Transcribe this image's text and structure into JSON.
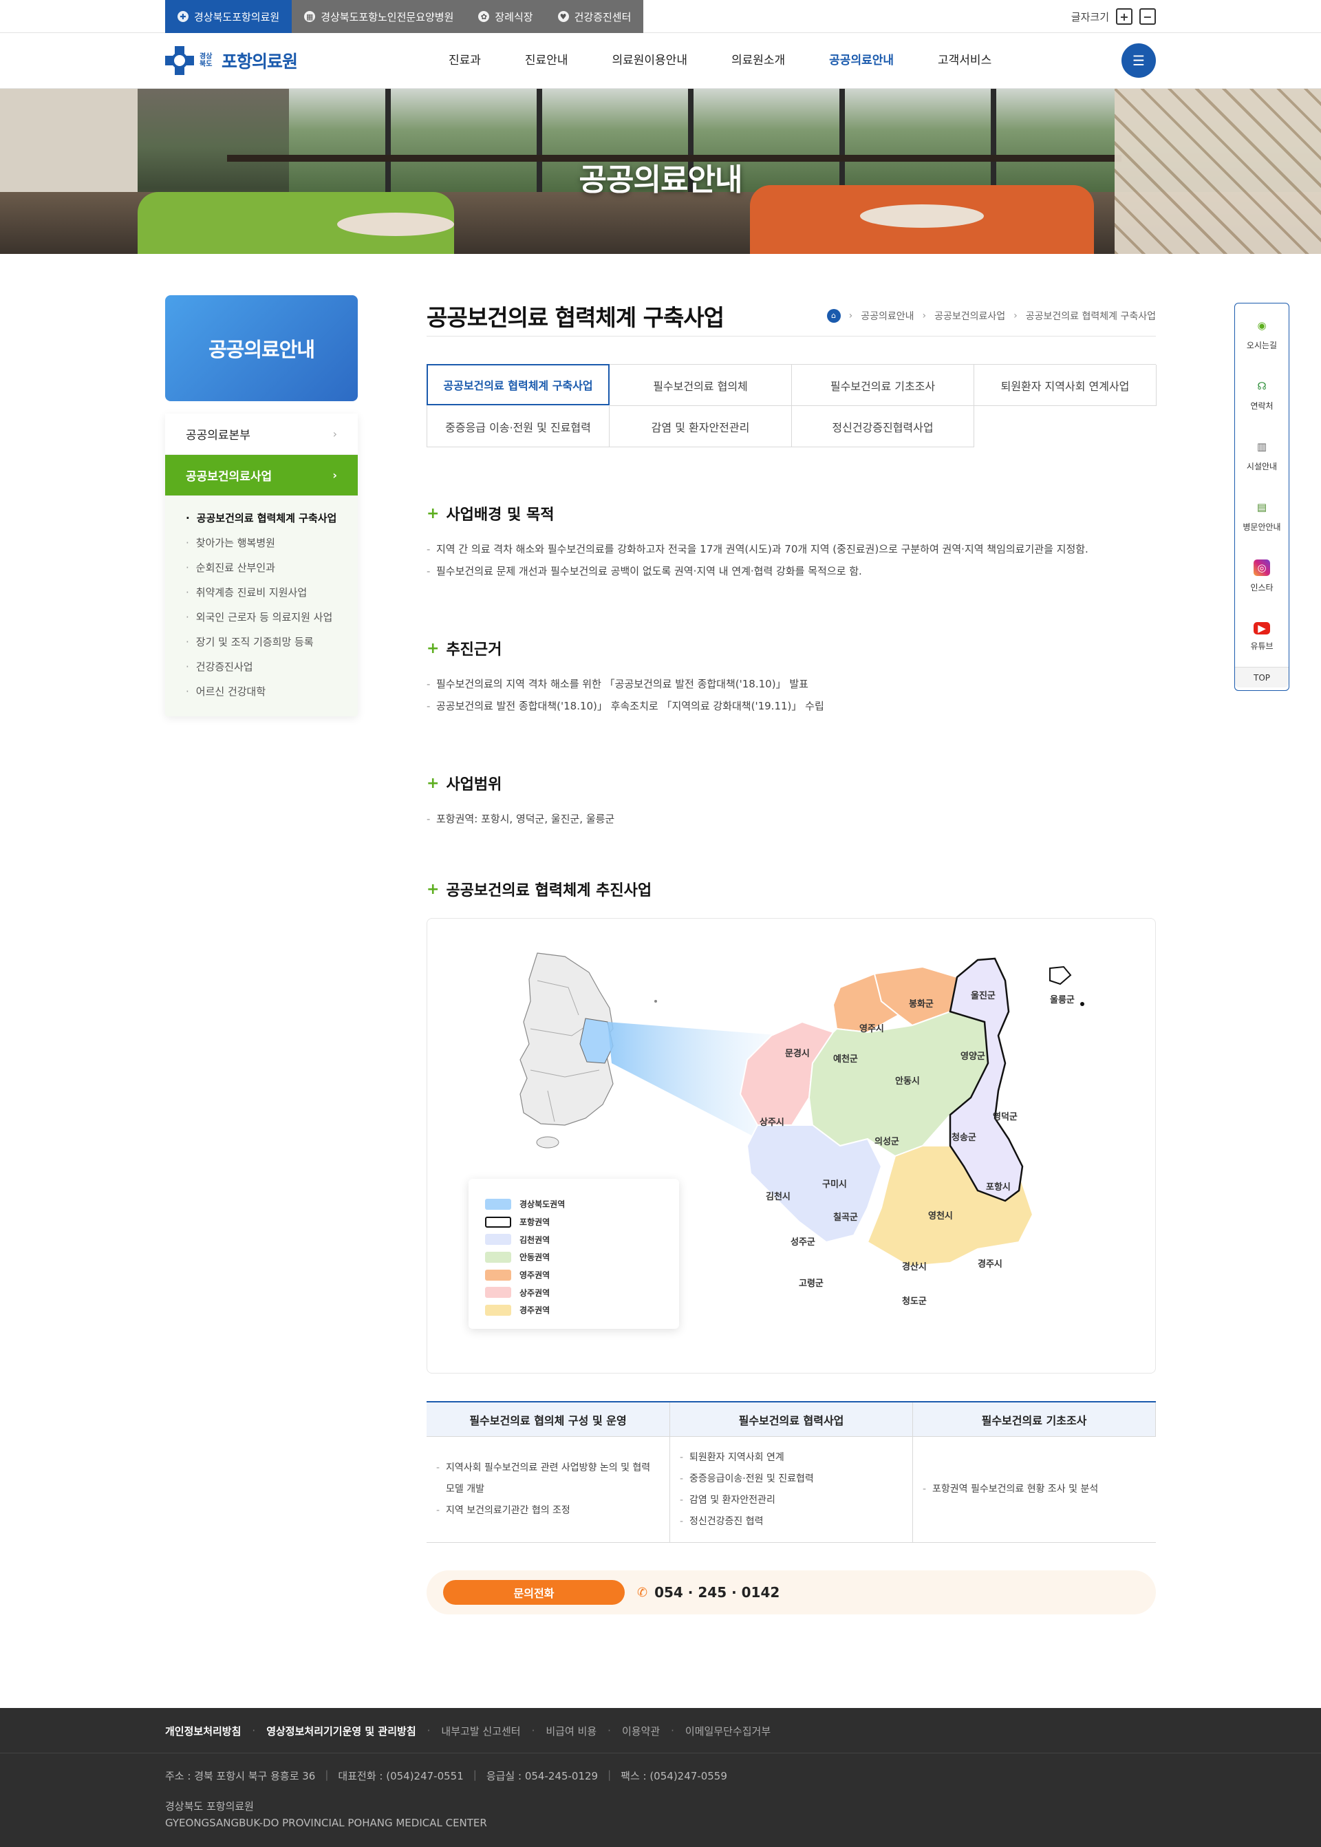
{
  "topbar": {
    "family": [
      {
        "label": "경상북도포항의료원",
        "icon": "cross-icon"
      },
      {
        "label": "경상북도포항노인전문요양병원",
        "icon": "building-icon"
      },
      {
        "label": "장례식장",
        "icon": "flower-icon"
      },
      {
        "label": "건강증진센터",
        "icon": "heart-icon"
      }
    ],
    "font_label": "글자크기",
    "font_plus": "+",
    "font_minus": "−"
  },
  "header": {
    "logo_small": "경상북도",
    "logo_name": "포항의료원",
    "menu": [
      "진료과",
      "진료안내",
      "의료원이용안내",
      "의료원소개",
      "공공의료안내",
      "고객서비스"
    ],
    "active_menu": "공공의료안내",
    "allmenu_icon": "☰"
  },
  "visual": {
    "title": "공공의료안내"
  },
  "lnb": {
    "title": "공공의료안내",
    "depth1": [
      {
        "label": "공공의료본부",
        "arrow": "›"
      },
      {
        "label": "공공보건의료사업",
        "arrow": "›"
      }
    ],
    "depth2": [
      "공공보건의료 협력체계 구축사업",
      "찾아가는 행복병원",
      "순회진료 산부인과",
      "취약계층 진료비 지원사업",
      "외국인 근로자 등 의료지원 사업",
      "장기 및 조직 기증희망 등록",
      "건강증진사업",
      "어르신 건강대학"
    ]
  },
  "page": {
    "title": "공공보건의료 협력체계 구축사업",
    "breadcrumb": [
      "공공의료안내",
      "공공보건의료사업",
      "공공보건의료 협력체계 구축사업"
    ],
    "breadcrumb_sep": "›"
  },
  "tabs": [
    "공공보건의료 협력체계 구축사업",
    "필수보건의료 협의체",
    "필수보건의료 기초조사",
    "퇴원환자 지역사회 연계사업",
    "중증응급 이송·전원 및 진료협력",
    "감염 및 환자안전관리",
    "정신건강증진협력사업"
  ],
  "sections": [
    {
      "title": "사업배경 및 목적",
      "items": [
        "지역 간 의료 격차 해소와 필수보건의료를 강화하고자 전국을 17개 권역(시도)과 70개 지역 (중진료권)으로 구분하여 권역·지역 책임의료기관을 지정함.",
        "필수보건의료 문제 개선과 필수보건의료 공백이 없도록 권역·지역 내 연계·협력 강화를 목적으로 함."
      ]
    },
    {
      "title": "추진근거",
      "items": [
        "필수보건의료의 지역 격차 해소를 위한 「공공보건의료 발전 종합대책('18.10)」 발표",
        "공공보건의료 발전 종합대책('18.10)」 후속조치로 「지역의료 강화대책('19.11)」 수립"
      ]
    },
    {
      "title": "사업범위",
      "items": [
        "포항권역: 포항시, 영덕군, 울진군, 울릉군"
      ]
    },
    {
      "title": "공공보건의료 협력체계 추진사업",
      "items": []
    }
  ],
  "map": {
    "legend": [
      {
        "label": "경상북도권역",
        "color": "#a8d4fb"
      },
      {
        "label": "포항권역",
        "color": "#ffffff"
      },
      {
        "label": "김천권역",
        "color": "#dfe6fb"
      },
      {
        "label": "안동권역",
        "color": "#d9ecc8"
      },
      {
        "label": "영주권역",
        "color": "#f9bb8c"
      },
      {
        "label": "상주권역",
        "color": "#fbcfcf"
      },
      {
        "label": "경주권역",
        "color": "#fae4a6"
      }
    ],
    "regions": [
      "울진군",
      "울릉군",
      "봉화군",
      "영주시",
      "영양군",
      "문경시",
      "예천군",
      "안동시",
      "영덕군",
      "상주시",
      "의성군",
      "청송군",
      "구미시",
      "포항시",
      "김천시",
      "칠곡군",
      "영천시",
      "성주군",
      "경산시",
      "경주시",
      "고령군",
      "청도군"
    ]
  },
  "table": {
    "headers": [
      "필수보건의료 협의체 구성 및 운영",
      "필수보건의료 협력사업",
      "필수보건의료 기초조사"
    ],
    "cols": [
      [
        "지역사회 필수보건의료 관련 사업방향 논의 및 협력 모델 개발",
        "지역 보건의료기관간 협의 조정"
      ],
      [
        "퇴원환자 지역사회 연계",
        "중증응급이송·전원 및 진료협력",
        "감염 및 환자안전관리",
        "정신건강증진 협력"
      ],
      [
        "포항권역 필수보건의료 현황 조사 및 분석"
      ]
    ]
  },
  "contact": {
    "button": "문의전화",
    "phone": "054 · 245 · 0142"
  },
  "quick": [
    {
      "label": "오시는길",
      "icon": "map-pin-icon"
    },
    {
      "label": "연락처",
      "icon": "headset-icon"
    },
    {
      "label": "시설안내",
      "icon": "building-icon"
    },
    {
      "label": "병문안안내",
      "icon": "clipboard-icon"
    },
    {
      "label": "인스타",
      "icon": "instagram-icon"
    },
    {
      "label": "유튜브",
      "icon": "youtube-icon"
    }
  ],
  "quick_top": "TOP",
  "footer": {
    "links": [
      "개인정보처리방침",
      "영상정보처리기기운영 및 관리방침",
      "내부고발 신고센터",
      "비급여 비용",
      "이용약관",
      "이메일무단수집거부"
    ],
    "address": "주소 : 경북 포항시 북구 용흥로 36",
    "tel": "대표전화 : (054)247-0551",
    "emergency": "응급실 : 054-245-0129",
    "fax": "팩스 : (054)247-0559",
    "org_ko": "경상북도 포항의료원",
    "org_en": "GYEONGSANGBUK-DO PROVINCIAL POHANG MEDICAL CENTER"
  },
  "colors": {
    "brand": "#1a5aad",
    "accent_green": "#5cae1e",
    "accent_orange": "#f47a1f"
  }
}
